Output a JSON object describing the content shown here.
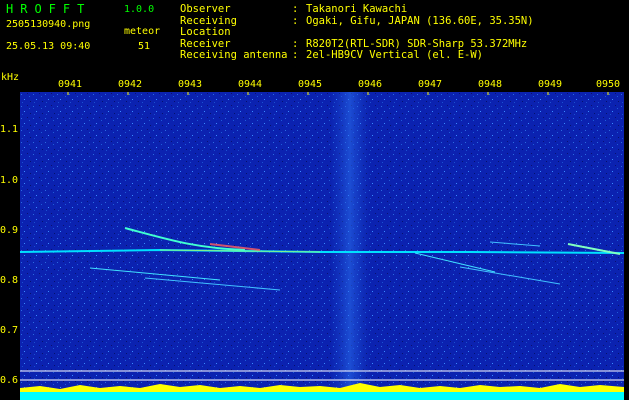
{
  "header": {
    "app_title": "HROFFT",
    "version": "1.0.0",
    "filename": "2505130940.png",
    "meteor_label": "meteor",
    "datetime": "25.05.13 09:40",
    "meteor_count": "51"
  },
  "info": [
    {
      "key": "Observer",
      "value": "Takanori Kawachi"
    },
    {
      "key": "Receiving Location",
      "value": "Ogaki, Gifu, JAPAN (136.60E, 35.35N)"
    },
    {
      "key": "Receiver",
      "value": "R820T2(RTL-SDR) SDR-Sharp 53.372MHz"
    },
    {
      "key": "Receiving antenna",
      "value": "2el-HB9CV Vertical (el. E-W)"
    }
  ],
  "axes": {
    "y_unit": "kHz",
    "y_ticks": [
      "1.1",
      "1.0",
      "0.9",
      "0.8",
      "0.7",
      "0.6"
    ],
    "x_ticks": [
      "0941",
      "0942",
      "0943",
      "0944",
      "0945",
      "0946",
      "0947",
      "0948",
      "0949",
      "0950"
    ]
  },
  "colors": {
    "background": "#0a1fa8",
    "label_yellow": "#ffff00",
    "title_green": "#00ff00",
    "signal_cyan": "#00ffff"
  }
}
